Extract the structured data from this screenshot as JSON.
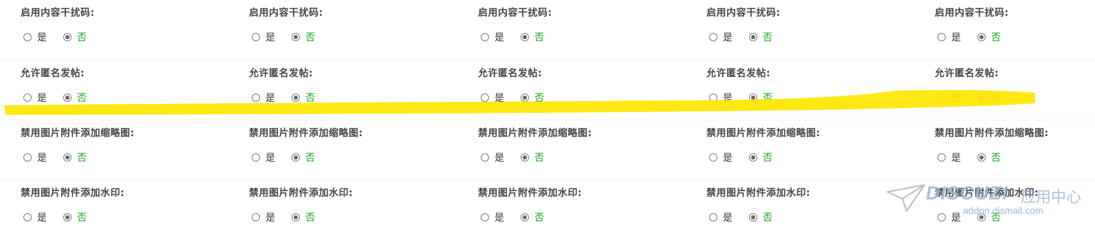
{
  "settings": {
    "option_yes": "是",
    "option_no": "否",
    "selected_option": "否"
  },
  "rows": [
    {
      "label": "启用内容干扰码:",
      "name": "content-interference"
    },
    {
      "label": "允许匿名发帖:",
      "name": "anonymous-post"
    },
    {
      "label": "禁用图片附件添加缩略图:",
      "name": "disable-thumbnail"
    },
    {
      "label": "禁用图片附件添加水印:",
      "name": "disable-watermark"
    }
  ],
  "columns_count": 5,
  "highlight_color": "#ffe600",
  "watermark": {
    "brand": "DISCUZ!",
    "brand_cn": "应用中心",
    "url": "addon.dismall.com"
  }
}
